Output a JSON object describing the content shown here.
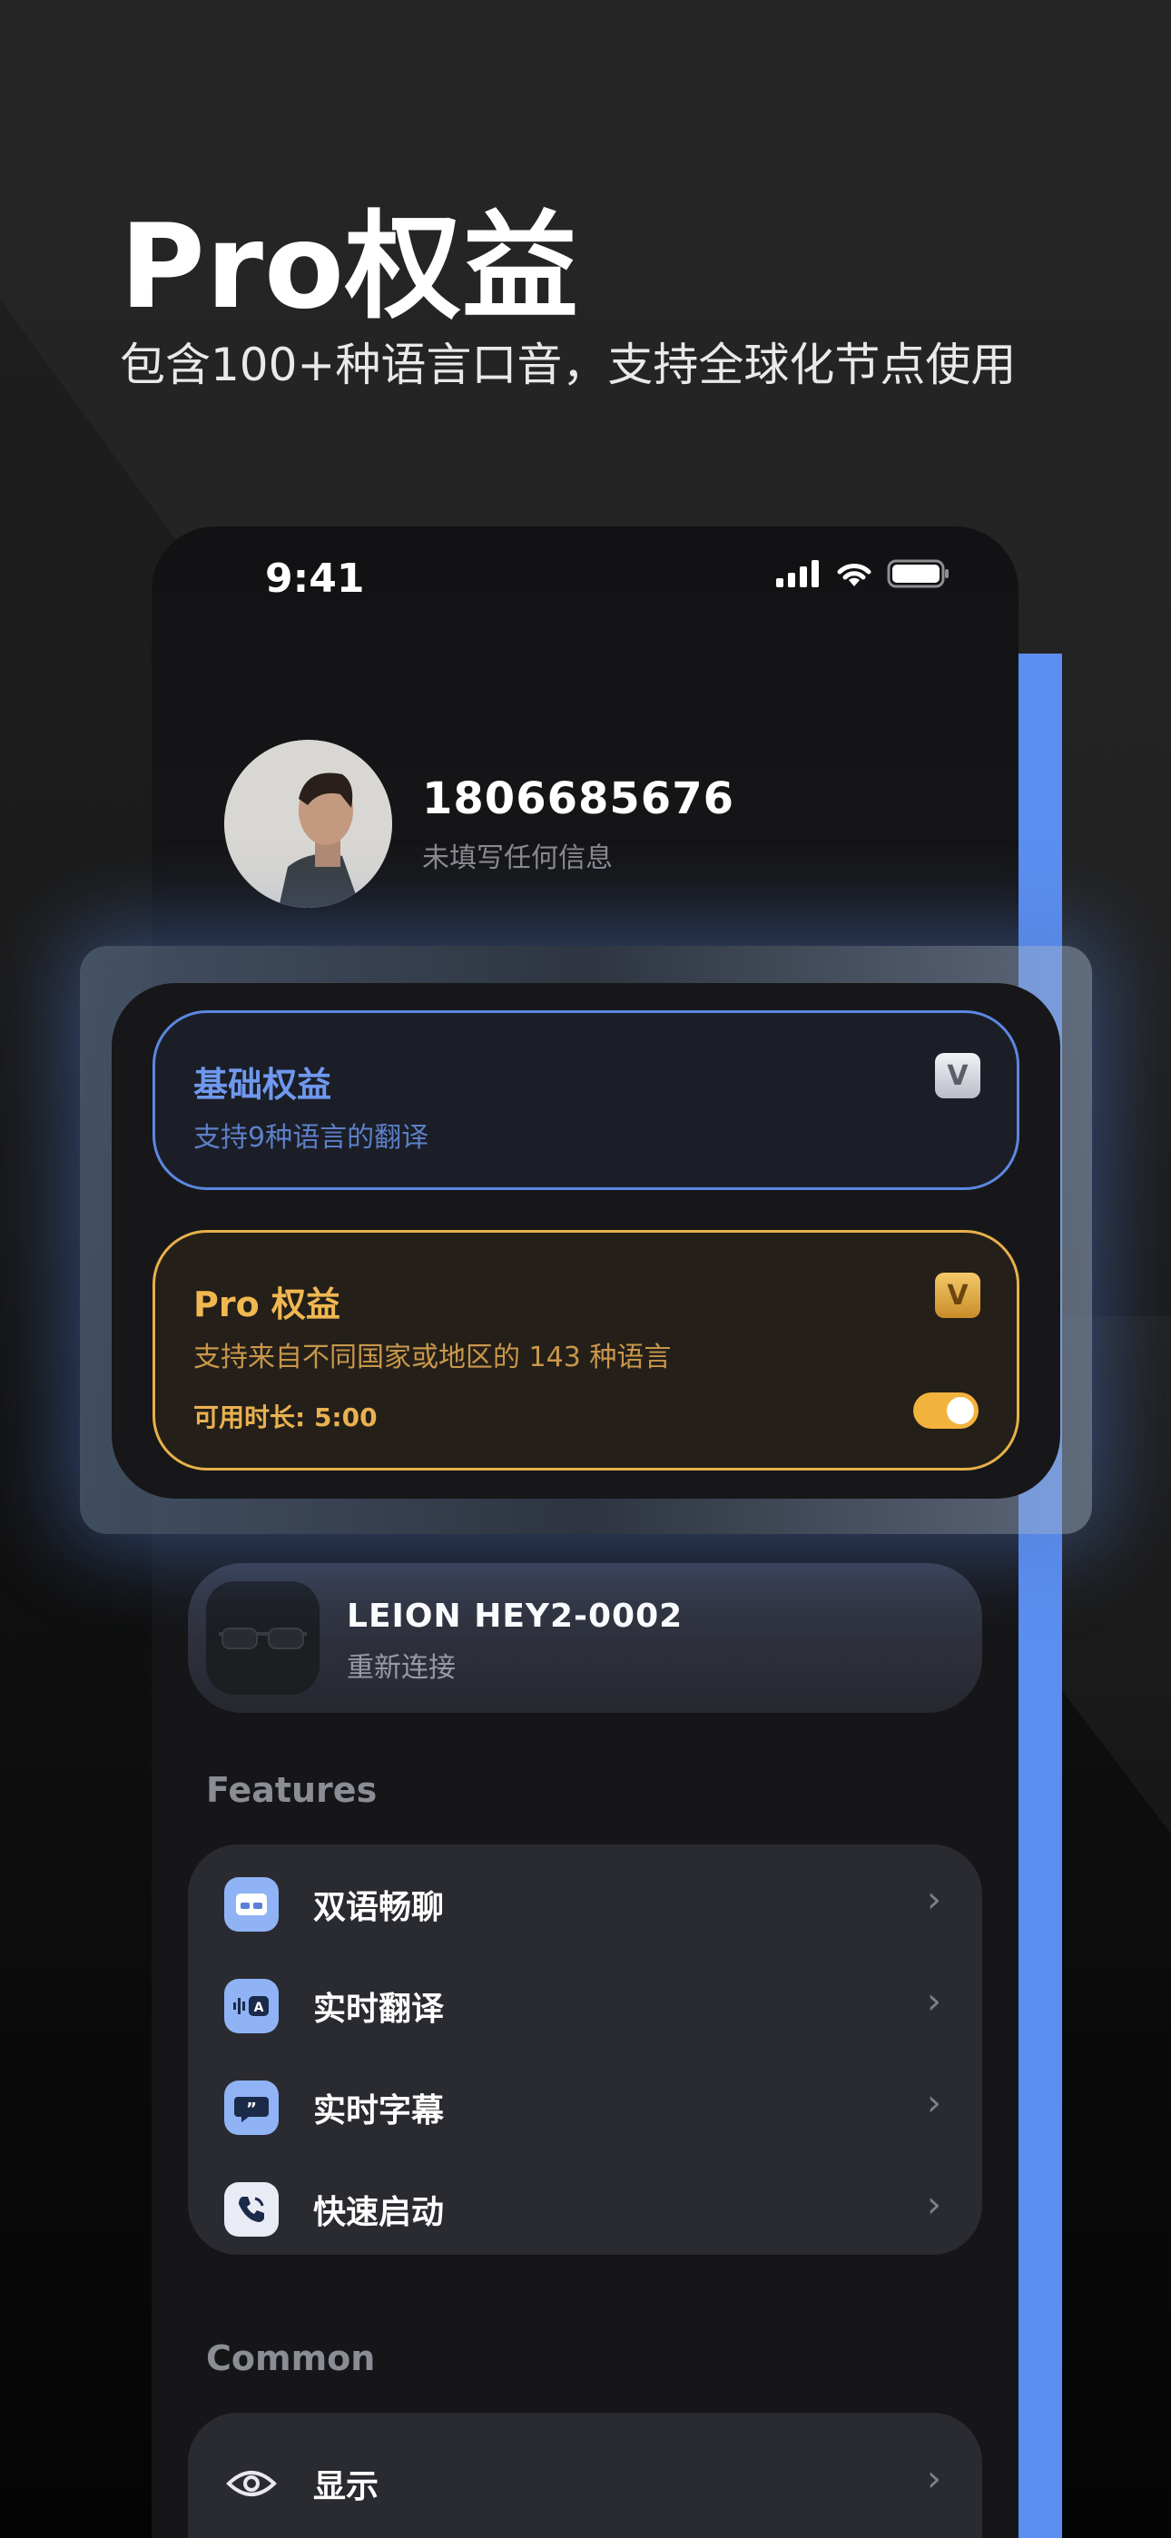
{
  "header": {
    "title": "Pro权益",
    "subtitle": "包含100+种语言口音，支持全球化节点使用"
  },
  "status_bar": {
    "time": "9:41"
  },
  "profile": {
    "phone": "1806685676",
    "subtitle": "未填写任何信息"
  },
  "rights": {
    "basic": {
      "title": "基础权益",
      "desc": "支持9种语言的翻译",
      "badge": "V"
    },
    "pro": {
      "title": "Pro 权益",
      "desc": "支持来自不同国家或地区的 143 种语言",
      "available": "可用时长: 5:00",
      "badge": "V",
      "toggle_on": true
    }
  },
  "device": {
    "name": "LEION HEY2-0002",
    "action": "重新连接"
  },
  "features": {
    "title": "Features",
    "items": [
      {
        "label": "双语畅聊",
        "icon": "chat-glasses-icon"
      },
      {
        "label": "实时翻译",
        "icon": "audio-translate-icon"
      },
      {
        "label": "实时字幕",
        "icon": "subtitle-quote-icon"
      },
      {
        "label": "快速启动",
        "icon": "phone-call-icon"
      }
    ]
  },
  "common": {
    "title": "Common",
    "items": [
      {
        "label": "显示",
        "icon": "eye-icon"
      }
    ]
  },
  "colors": {
    "accent_blue": "#5b8ef0",
    "pro_gold": "#f1b851",
    "basic_blue": "#6f98ee"
  }
}
